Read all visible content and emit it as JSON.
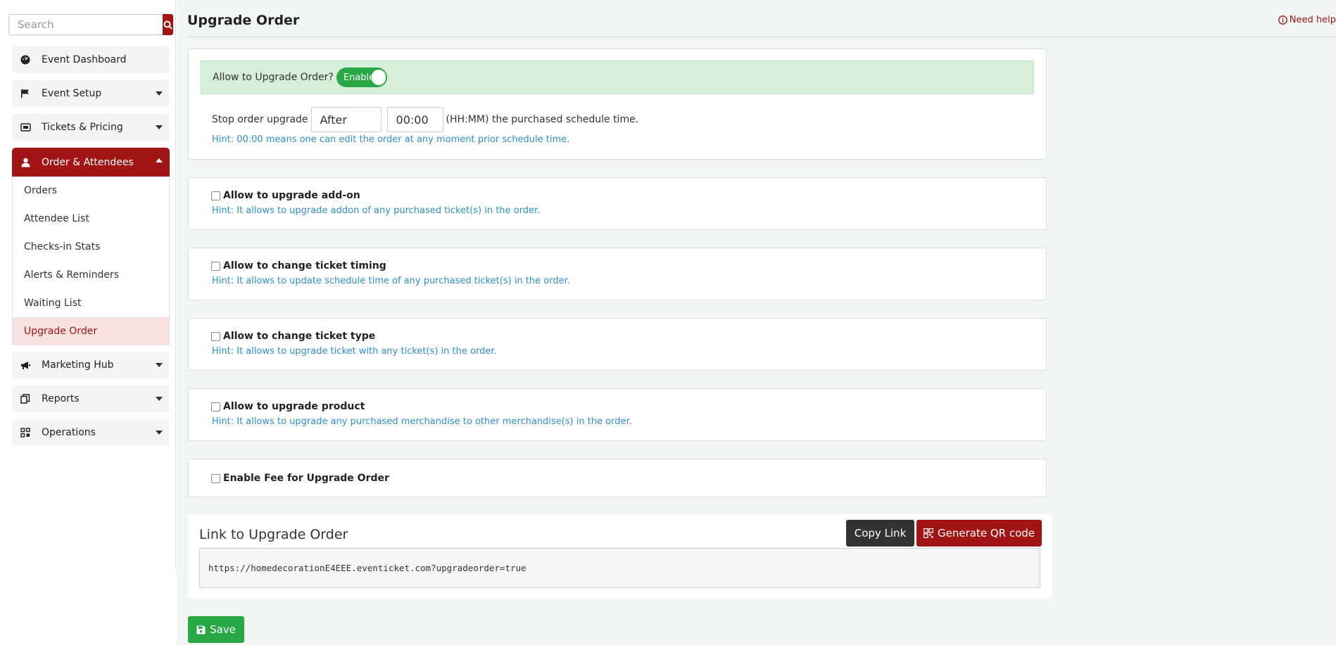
{
  "search": {
    "placeholder": "Search"
  },
  "sidebar": {
    "items": [
      {
        "label": "Event Dashboard"
      },
      {
        "label": "Event Setup"
      },
      {
        "label": "Tickets & Pricing"
      },
      {
        "label": "Order & Attendees"
      },
      {
        "label": "Marketing Hub"
      },
      {
        "label": "Reports"
      },
      {
        "label": "Operations"
      }
    ],
    "submenu": [
      {
        "label": "Orders"
      },
      {
        "label": "Attendee List"
      },
      {
        "label": "Checks-in Stats"
      },
      {
        "label": "Alerts & Reminders"
      },
      {
        "label": "Waiting List"
      },
      {
        "label": "Upgrade Order"
      }
    ]
  },
  "header": {
    "title": "Upgrade Order",
    "help": "Need help"
  },
  "upgrade": {
    "allow_label": "Allow to Upgrade Order?",
    "toggle_label": "Enable",
    "stop_prefix": "Stop order upgrade",
    "stop_when": "After",
    "stop_time": "00:00",
    "stop_suffix": "(HH:MM) the purchased schedule time.",
    "stop_hint": "Hint: 00:00 means one can edit the order at any moment prior schedule time."
  },
  "options": [
    {
      "label": "Allow to upgrade add-on",
      "hint": "Hint: It allows to upgrade addon of any purchased ticket(s) in the order."
    },
    {
      "label": "Allow to change ticket timing",
      "hint": "Hint: It allows to update schedule time of any purchased ticket(s) in the order."
    },
    {
      "label": "Allow to change ticket type",
      "hint": "Hint: It allows to upgrade ticket with any ticket(s) in the order."
    },
    {
      "label": "Allow to upgrade product",
      "hint": "Hint: It allows to upgrade any purchased merchandise to other merchandise(s) in the order."
    }
  ],
  "fee": {
    "label": "Enable Fee for Upgrade Order"
  },
  "link": {
    "title": "Link to Upgrade Order",
    "copy_label": "Copy Link",
    "qr_label": "Generate QR code",
    "url": "https://homedecorationE4EEE.eventicket.com?upgradeorder=true"
  },
  "save_label": "Save",
  "colors": {
    "brand": "#a31515",
    "success": "#28a745",
    "hint": "#2d8fc9"
  },
  "icons": [
    "search-icon",
    "dashboard-icon",
    "flag-icon",
    "ticket-icon",
    "user-icon",
    "megaphone-icon",
    "reports-icon",
    "operations-icon",
    "info-icon",
    "qr-icon",
    "save-icon"
  ]
}
